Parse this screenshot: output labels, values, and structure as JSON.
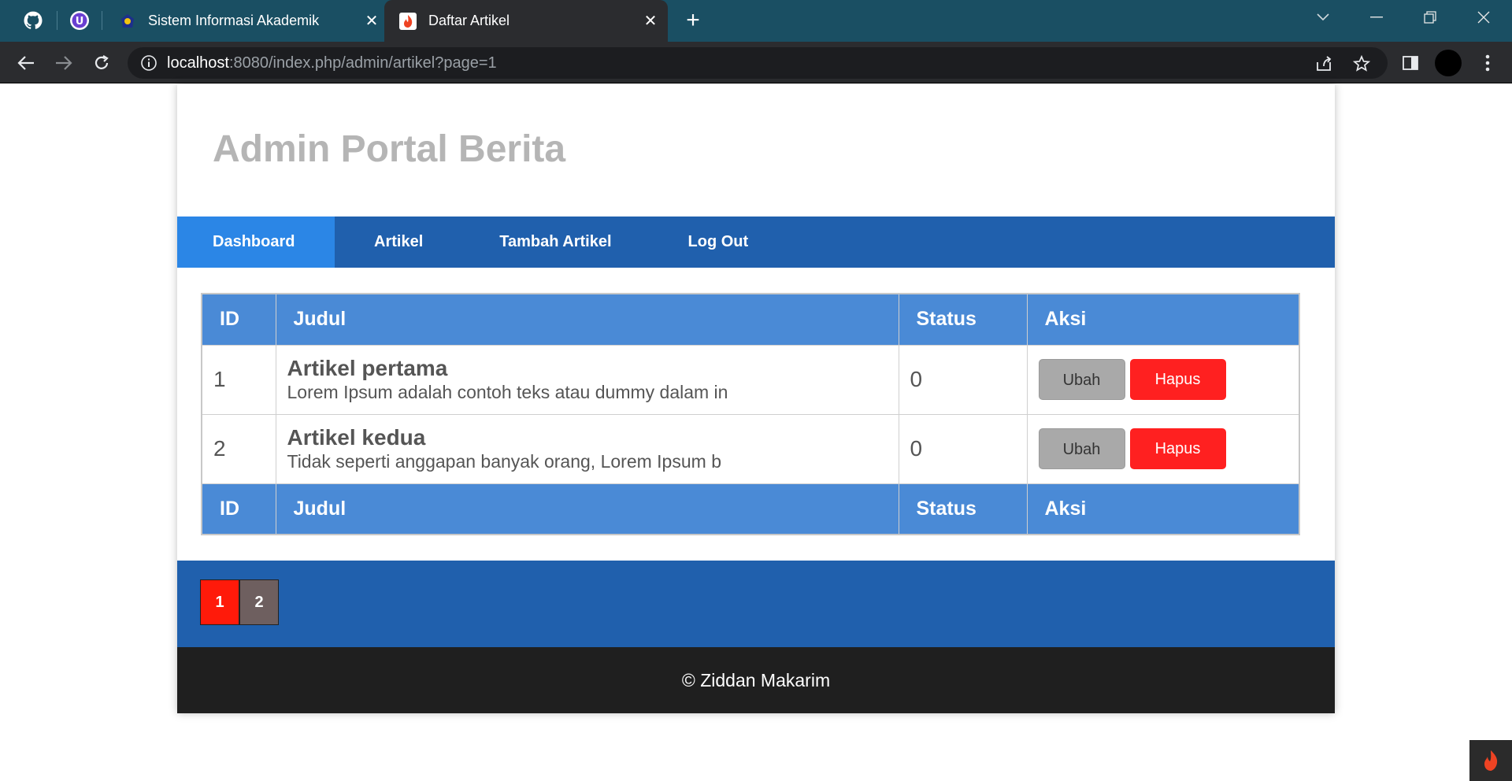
{
  "browser": {
    "tabs": [
      {
        "title": "Sistem Informasi Akademik",
        "favicon": "university-logo-icon",
        "active": false
      },
      {
        "title": "Daftar Artikel",
        "favicon": "codeigniter-flame-icon",
        "active": true
      }
    ],
    "close_glyph": "✕",
    "newtab_glyph": "+",
    "url_host": "localhost",
    "url_rest": ":8080/index.php/admin/artikel?page=1"
  },
  "site": {
    "title": "Admin Portal Berita"
  },
  "nav": {
    "items": [
      "Dashboard",
      "Artikel",
      "Tambah Artikel",
      "Log Out"
    ],
    "active": "Dashboard"
  },
  "table": {
    "headers": [
      "ID",
      "Judul",
      "Status",
      "Aksi"
    ],
    "rows": [
      {
        "id": "1",
        "title": "Artikel pertama",
        "excerpt": "Lorem Ipsum adalah contoh teks atau dummy dalam in",
        "status": "0",
        "edit_label": "Ubah",
        "delete_label": "Hapus"
      },
      {
        "id": "2",
        "title": "Artikel kedua",
        "excerpt": "Tidak seperti anggapan banyak orang, Lorem Ipsum b",
        "status": "0",
        "edit_label": "Ubah",
        "delete_label": "Hapus"
      }
    ],
    "footer_headers": [
      "ID",
      "Judul",
      "Status",
      "Aksi"
    ]
  },
  "pagination": {
    "pages": [
      "1",
      "2"
    ],
    "current": "1"
  },
  "footer": {
    "text": "© Ziddan Makarim"
  },
  "colors": {
    "nav_bg": "#2060ad",
    "nav_active": "#2b86e6",
    "table_header": "#4a8ad6",
    "delete_button": "#ff2020",
    "edit_button": "#a9a9a9",
    "page_current": "#ff1a0a"
  }
}
